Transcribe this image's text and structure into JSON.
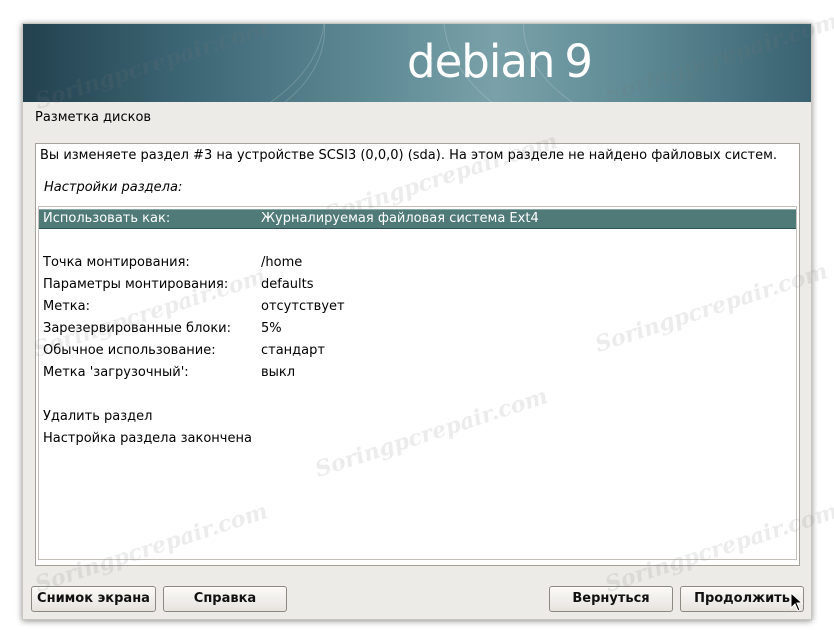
{
  "installer": {
    "brand": "debian",
    "version": "9",
    "section_title": "Разметка дисков"
  },
  "partition": {
    "description": "Вы изменяете раздел #3 на устройстве SCSI3 (0,0,0) (sda). На этом разделе не найдено файловых систем.",
    "settings_heading": "Настройки раздела:",
    "rows": [
      {
        "label": "Использовать как:",
        "value": "Журналируемая файловая система Ext4",
        "selected": true
      },
      {
        "label": "Точка монтирования:",
        "value": "/home"
      },
      {
        "label": "Параметры монтирования:",
        "value": "defaults"
      },
      {
        "label": "Метка:",
        "value": "отсутствует"
      },
      {
        "label": "Зарезервированные блоки:",
        "value": "5%"
      },
      {
        "label": "Обычное использование:",
        "value": "стандарт"
      },
      {
        "label": "Метка 'загрузочный':",
        "value": "выкл"
      }
    ],
    "actions": [
      "Удалить раздел",
      "Настройка раздела закончена"
    ]
  },
  "buttons": {
    "screenshot": "Снимок экрана",
    "help": "Справка",
    "back": "Вернуться",
    "continue": "Продолжить"
  },
  "watermark": "Soringpcrepair.com",
  "colors": {
    "selected_row": "#4f7a78",
    "window_bg": "#edebe7"
  }
}
